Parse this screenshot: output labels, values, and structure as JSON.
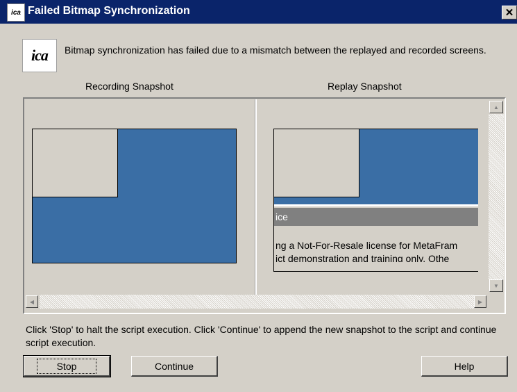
{
  "window": {
    "title": "Failed Bitmap Synchronization",
    "icon": "ica-icon",
    "icon_text": "ica",
    "close_glyph": "✕"
  },
  "message": "Bitmap synchronization has failed due to a mismatch between the replayed and recorded screens.",
  "logo_text": "ica",
  "recording": {
    "label": "Recording Snapshot"
  },
  "replay": {
    "label": "Replay Snapshot",
    "dialog_title": "ice",
    "line1": "ng a Not-For-Resale license for MetaFram",
    "line2": "ict demonstration and training only. Othe"
  },
  "instructions": "Click 'Stop' to halt the script execution. Click 'Continue' to append the new snapshot to the script and continue script execution.",
  "buttons": {
    "stop": "Stop",
    "continue": "Continue",
    "help": "Help"
  },
  "colors": {
    "titlebar": "#0a246a",
    "desktop": "#3a6ea5",
    "face": "#d4d0c8"
  }
}
